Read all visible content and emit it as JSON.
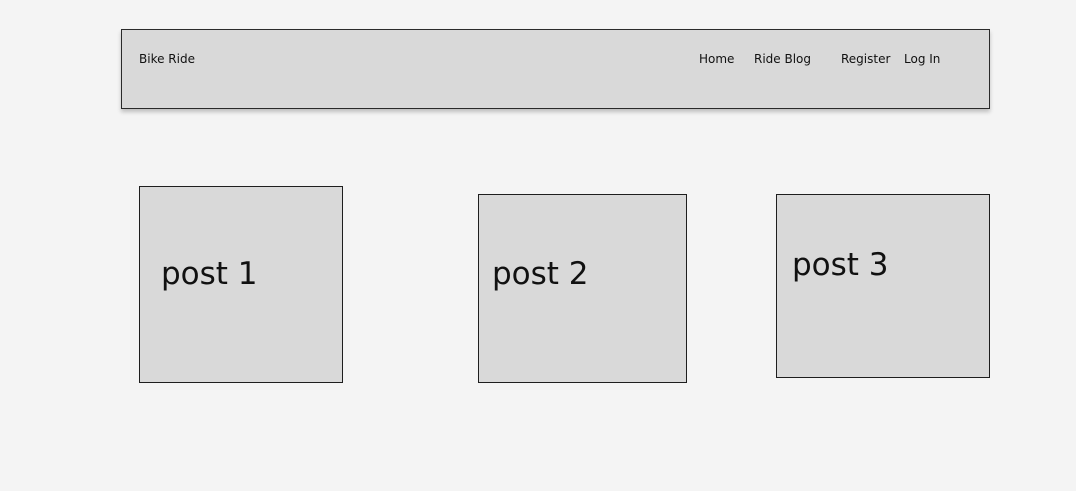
{
  "navbar": {
    "brand": "Bike Ride",
    "links": [
      "Home",
      "Ride Blog",
      "Register",
      "Log In"
    ]
  },
  "posts": [
    "post 1",
    "post 2",
    "post 3"
  ]
}
